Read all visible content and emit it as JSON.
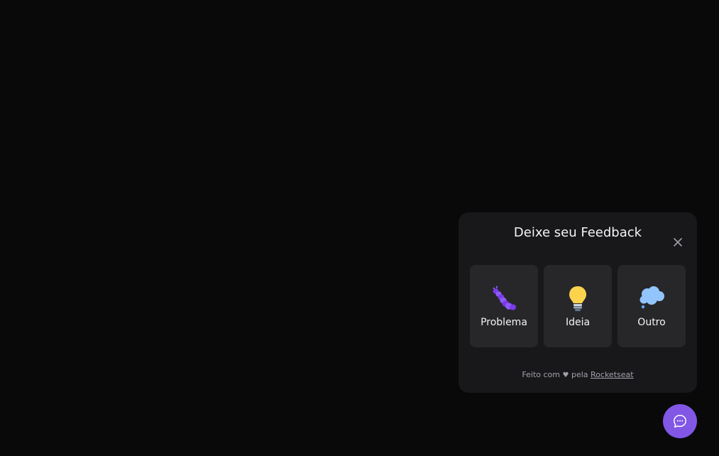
{
  "widget": {
    "title": "Deixe seu Feedback",
    "close_icon": "close-icon",
    "options": [
      {
        "label": "Problema",
        "icon": "bug-icon"
      },
      {
        "label": "Ideia",
        "icon": "lightbulb-icon"
      },
      {
        "label": "Outro",
        "icon": "thought-bubble-icon"
      }
    ],
    "footer": {
      "prefix": "Feito com",
      "heart": "♥",
      "middle": "pela",
      "link": "Rocketseat"
    }
  },
  "fab": {
    "icon": "chat-bubble-icon",
    "color": "#8257e5"
  },
  "colors": {
    "background": "#09090a",
    "panel": "#18181b",
    "card": "#27272a",
    "brand": "#8257e5"
  }
}
